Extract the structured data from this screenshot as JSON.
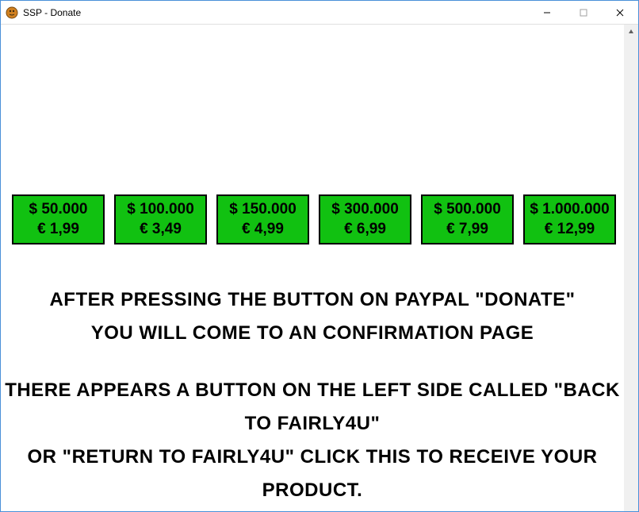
{
  "window": {
    "title": "SSP - Donate"
  },
  "buttons": [
    {
      "usd": "$ 50.000",
      "eur": "€ 1,99"
    },
    {
      "usd": "$ 100.000",
      "eur": "€ 3,49"
    },
    {
      "usd": "$ 150.000",
      "eur": "€ 4,99"
    },
    {
      "usd": "$ 300.000",
      "eur": "€ 6,99"
    },
    {
      "usd": "$ 500.000",
      "eur": "€ 7,99"
    },
    {
      "usd": "$ 1.000.000",
      "eur": "€ 12,99"
    }
  ],
  "messages": {
    "line1": "After pressing the button on paypal \"Donate\"",
    "line2": "you will come to an confirmation page",
    "line3": "There appears a button on the left side called \"back to fairly4u\"",
    "line4": "or \"return to fairly4u\" click this to receive your product."
  }
}
